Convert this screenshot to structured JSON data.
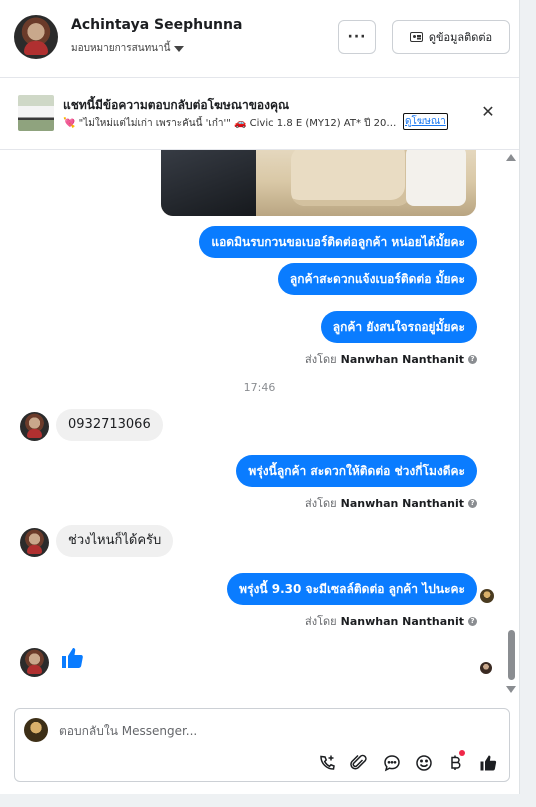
{
  "header": {
    "contact_name": "Achintaya Seephunna",
    "assign_label": "มอบหมายการสนทนานี้",
    "more_label": "···",
    "contact_info_label": "ดูข้อมูลติดต่อ"
  },
  "ad_banner": {
    "title": "แชทนี้มีข้อความตอบกลับต่อโฆษณาของคุณ",
    "subtitle": "💘 \"ไม่ใหม่แต่ไม่เก่า เพราะคันนี้ 'เก๋า'\" 🚗 Civic 1.8 E (MY12) AT* ปี 201...",
    "link_label": "ดูโฆษณา",
    "close_label": "✕"
  },
  "messages": {
    "out_1": "แอดมินรบกวนขอเบอร์ติดต่อลูกค้า หน่อยได้มั้ยคะ",
    "out_2": "ลูกค้าสะดวกแจ้งเบอร์ติดต่อ มั้ยคะ",
    "out_3": "ลูกค้า ยังสนใจรถอยู่มั้ยคะ",
    "sent_by_prefix": "ส่งโดย",
    "sent_by_name": "Nanwhan Nanthanit",
    "time_divider": "17:46",
    "in_1": "0932713066",
    "out_4": "พรุ่งนี้ลูกค้า สะดวกให้ติดต่อ ช่วงกี่โมงดีคะ",
    "in_2": "ช่วงไหนก็ได้ครับ",
    "out_5": "พรุ่งนี้  9.30 จะมีเซลล์ติดต่อ ลูกค้า ไปนะคะ"
  },
  "composer": {
    "placeholder": "ตอบกลับใน Messenger..."
  },
  "colors": {
    "outgoing_bubble": "#0a7cff",
    "incoming_bubble": "#f0f0f0",
    "link": "#1877f2",
    "like_icon": "#0a7cff"
  },
  "icons": [
    "caret-down-icon",
    "contact-card-icon",
    "close-icon",
    "info-icon",
    "thumbs-up-icon",
    "call-add-icon",
    "attachment-icon",
    "saved-reply-icon",
    "emoji-icon",
    "baht-icon",
    "like-send-icon"
  ]
}
